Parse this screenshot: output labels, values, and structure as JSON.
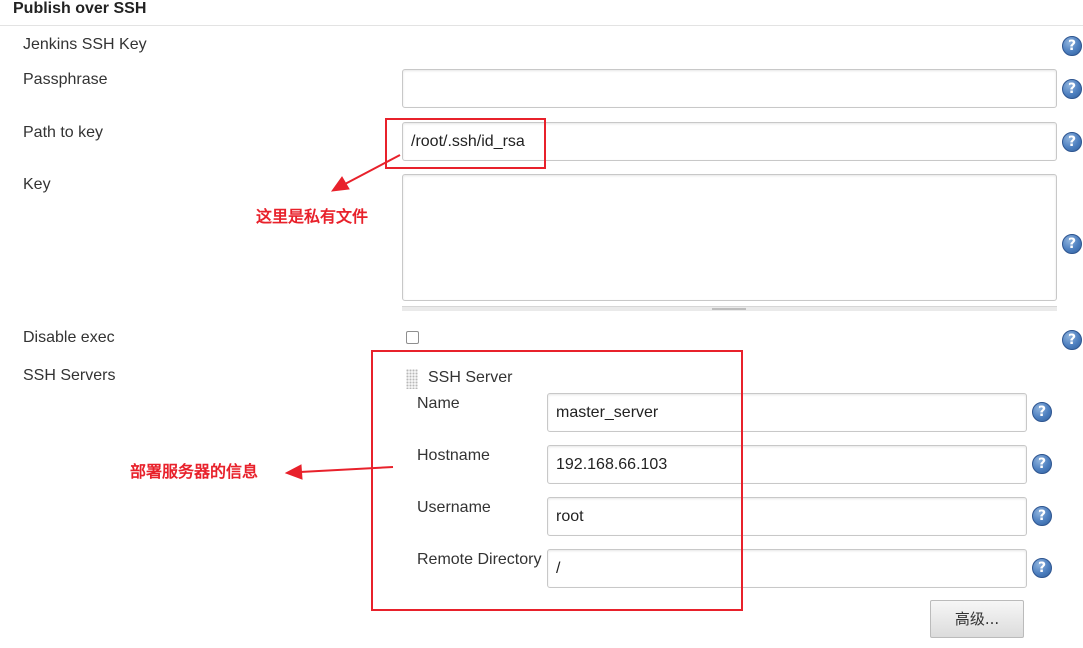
{
  "section": {
    "title": "Publish over SSH"
  },
  "fields": {
    "jenkins_ssh_key": {
      "label": "Jenkins SSH Key"
    },
    "passphrase": {
      "label": "Passphrase",
      "value": ""
    },
    "path_to_key": {
      "label": "Path to key",
      "value": "/root/.ssh/id_rsa"
    },
    "key": {
      "label": "Key",
      "value": ""
    },
    "disable_exec": {
      "label": "Disable exec",
      "checked": false
    },
    "ssh_servers": {
      "label": "SSH Servers"
    }
  },
  "ssh_server": {
    "heading": "SSH Server",
    "name": {
      "label": "Name",
      "value": "master_server"
    },
    "hostname": {
      "label": "Hostname",
      "value": "192.168.66.103"
    },
    "username": {
      "label": "Username",
      "value": "root"
    },
    "remote_directory": {
      "label": "Remote Directory",
      "value": "/"
    },
    "advanced_button": "高级..."
  },
  "help_glyph": "?",
  "annotations": {
    "private_key_note": "这里是私有文件",
    "server_info_note": "部署服务器的信息"
  },
  "colors": {
    "annotation_red": "#e8212b",
    "help_blue": "#4d7fbf"
  },
  "icons": {
    "help": "help-icon",
    "drag": "drag-handle-icon",
    "arrow": "red-arrow"
  }
}
